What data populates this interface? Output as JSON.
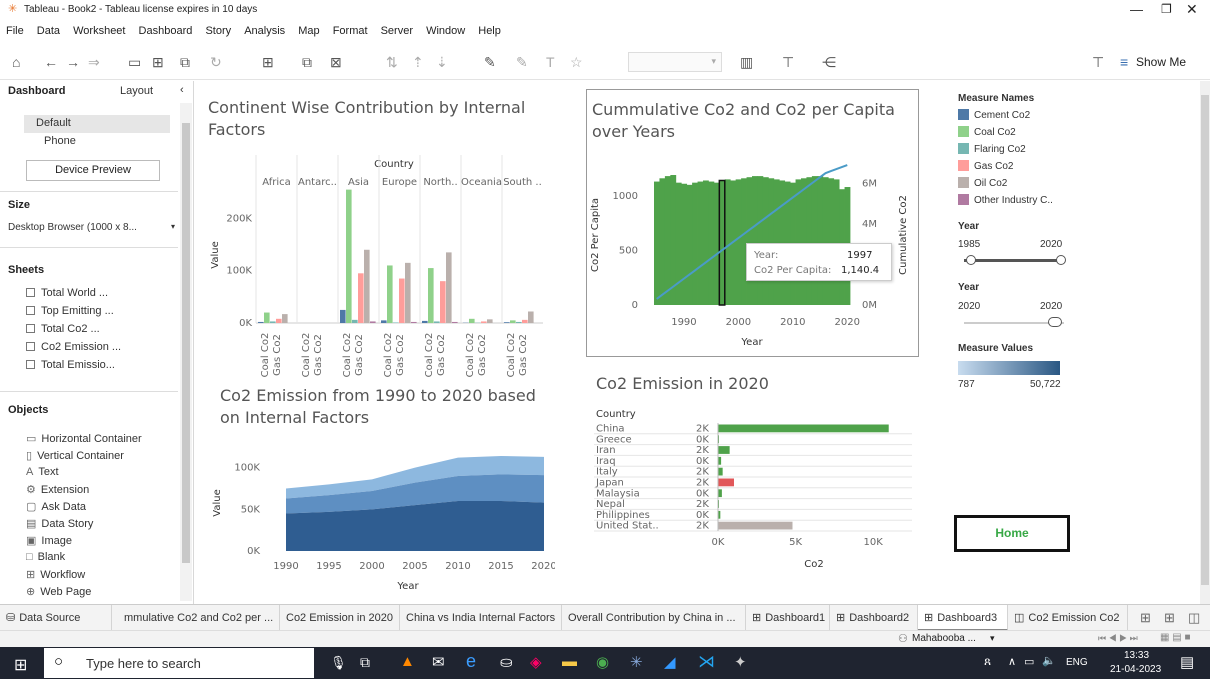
{
  "window": {
    "title": "Tableau - Book2 - Tableau license expires in 10 days"
  },
  "menu": [
    "File",
    "Data",
    "Worksheet",
    "Dashboard",
    "Story",
    "Analysis",
    "Map",
    "Format",
    "Server",
    "Window",
    "Help"
  ],
  "toolbar": {
    "show_me": "Show Me"
  },
  "left_pane": {
    "tab_dashboard": "Dashboard",
    "tab_layout": "Layout",
    "devices": [
      "Default",
      "Phone"
    ],
    "device_preview": "Device Preview",
    "size_heading": "Size",
    "size_value": "Desktop Browser (1000 x 8...",
    "sheets_heading": "Sheets",
    "sheets": [
      "Total World ...",
      "Top Emitting ...",
      "Total Co2 ...",
      "Co2 Emission ...",
      "Total Emissio..."
    ],
    "objects_heading": "Objects",
    "objects": [
      "Horizontal Container",
      "Vertical Container",
      "Text",
      "Extension",
      "Ask Data",
      "Data Story",
      "Image",
      "Blank",
      "Workflow",
      "Web Page"
    ]
  },
  "chart1": {
    "title": "Continent Wise Contribution by Internal Factors",
    "header": "Country",
    "ylabel": "Value"
  },
  "chart2": {
    "title": "Cummulative Co2 and Co2 per Capita over Years",
    "ylabel": "Co2 Per Capita",
    "y2label": "Cumulative Co2",
    "xlabel": "Year",
    "tooltip": {
      "year_label": "Year:",
      "year_value": "1997",
      "capita_label": "Co2 Per Capita:",
      "capita_value": "1,140.4"
    }
  },
  "chart3": {
    "title": "Co2 Emission from 1990 to 2020 based on Internal Factors",
    "ylabel": "Value",
    "xlabel": "Year"
  },
  "chart4": {
    "title": "Co2 Emission in 2020",
    "header": "Country",
    "xlabel": "Co2"
  },
  "legend": {
    "measure_names": "Measure Names",
    "items": [
      {
        "label": "Cement Co2",
        "color": "#4e79a7"
      },
      {
        "label": "Coal Co2",
        "color": "#8fd18a"
      },
      {
        "label": "Flaring Co2",
        "color": "#76b7b2"
      },
      {
        "label": "Gas Co2",
        "color": "#ff9d9a"
      },
      {
        "label": "Oil Co2",
        "color": "#bab0ac"
      },
      {
        "label": "Other Industry C..",
        "color": "#b07aa1"
      }
    ],
    "year1": {
      "label": "Year",
      "min": "1985",
      "max": "2020"
    },
    "year2": {
      "label": "Year",
      "min": "2020",
      "max": "2020"
    },
    "measure_values": {
      "label": "Measure Values",
      "min": "787",
      "max": "50,722"
    },
    "home_button": "Home"
  },
  "tabs": [
    "Data Source",
    "mmulative Co2 and Co2 per ...",
    "Co2 Emission in 2020",
    "China vs India Internal Factors",
    "Overall Contribution by China in ...",
    "Dashboard1",
    "Dashboard2",
    "Dashboard3",
    "Co2 Emission Co2"
  ],
  "status": {
    "user": "Mahabooba ..."
  },
  "taskbar": {
    "search_placeholder": "Type here to search",
    "lang": "ENG",
    "time": "13:33",
    "date": "21-04-2023"
  },
  "chart_data": [
    {
      "type": "bar",
      "title": "Continent Wise Contribution by Internal Factors",
      "ylabel": "Value",
      "ylim": [
        0,
        260000
      ],
      "categories": [
        "Africa",
        "Antarc..",
        "Asia",
        "Europe",
        "North..",
        "Oceania",
        "South .."
      ],
      "series": [
        {
          "name": "Cement Co2",
          "values": [
            2000,
            0,
            25000,
            5000,
            4000,
            500,
            1500
          ]
        },
        {
          "name": "Coal Co2",
          "values": [
            20000,
            0,
            255000,
            110000,
            105000,
            8000,
            5000
          ]
        },
        {
          "name": "Flaring Co2",
          "values": [
            3000,
            0,
            6000,
            1000,
            3000,
            500,
            2000
          ]
        },
        {
          "name": "Gas Co2",
          "values": [
            8000,
            0,
            95000,
            85000,
            80000,
            3000,
            6000
          ]
        },
        {
          "name": "Oil Co2",
          "values": [
            17000,
            0,
            140000,
            115000,
            135000,
            7000,
            22000
          ]
        },
        {
          "name": "Other Industry Co2",
          "values": [
            0,
            0,
            3000,
            2000,
            2000,
            0,
            0
          ]
        }
      ],
      "yticks": [
        "0K",
        "100K",
        "200K"
      ]
    },
    {
      "type": "bar",
      "title": "Cummulative Co2 and Co2 per Capita over Years",
      "x": [
        1985,
        2020
      ],
      "ylabel": "Co2 Per Capita",
      "ylim": [
        0,
        1300
      ],
      "y2label": "Cumulative Co2",
      "y2lim": [
        0,
        7000000
      ],
      "bar_values": [
        1130,
        1160,
        1180,
        1190,
        1120,
        1110,
        1100,
        1120,
        1130,
        1140,
        1130,
        1120,
        1140,
        1150,
        1140,
        1150,
        1160,
        1170,
        1180,
        1180,
        1170,
        1160,
        1150,
        1140,
        1130,
        1120,
        1150,
        1160,
        1170,
        1180,
        1180,
        1170,
        1160,
        1150,
        1060,
        1080
      ],
      "line_values": [
        0.3,
        0.5,
        0.7,
        0.9,
        1.1,
        1.3,
        1.5,
        1.7,
        1.9,
        2.1,
        2.3,
        2.5,
        2.7,
        2.9,
        3.1,
        3.3,
        3.5,
        3.7,
        3.9,
        4.1,
        4.3,
        4.5,
        4.7,
        4.9,
        5.1,
        5.3,
        5.5,
        5.7,
        5.9,
        6.1,
        6.3,
        6.5,
        6.6,
        6.7,
        6.8,
        6.9
      ],
      "xticks": [
        "1990",
        "2000",
        "2010",
        "2020"
      ],
      "yticks": [
        "0",
        "500",
        "1000"
      ],
      "y2ticks": [
        "0M",
        "4M",
        "6M"
      ]
    },
    {
      "type": "area",
      "title": "Co2 Emission from 1990 to 2020 based on Internal Factors",
      "ylabel": "Value",
      "xlabel": "Year",
      "ylim": [
        0,
        120000
      ],
      "x": [
        1990,
        1995,
        2000,
        2005,
        2010,
        2015,
        2020
      ],
      "series": [
        {
          "name": "Oil Co2",
          "values": [
            45000,
            47000,
            50000,
            55000,
            60000,
            60000,
            58000
          ]
        },
        {
          "name": "Gas Co2",
          "values": [
            18000,
            20000,
            22000,
            27000,
            30000,
            32000,
            33000
          ]
        },
        {
          "name": "Coal Co2",
          "values": [
            12000,
            13000,
            14000,
            18000,
            22000,
            22000,
            22000
          ]
        }
      ],
      "xticks": [
        "1990",
        "1995",
        "2000",
        "2005",
        "2010",
        "2015",
        "2020"
      ],
      "yticks": [
        "0K",
        "50K",
        "100K"
      ]
    },
    {
      "type": "bar",
      "title": "Co2 Emission in 2020",
      "xlabel": "Co2",
      "categories": [
        "China",
        "Greece",
        "Iran",
        "Iraq",
        "Italy",
        "Japan",
        "Malaysia",
        "Nepal",
        "Philippines",
        "United Stat.."
      ],
      "values": [
        11000,
        20,
        750,
        200,
        300,
        1030,
        250,
        10,
        150,
        4800
      ],
      "row_values": [
        "2K",
        "0K",
        "2K",
        "0K",
        "2K",
        "2K",
        "0K",
        "2K",
        "0K",
        "2K"
      ],
      "xticks": [
        "0K",
        "5K",
        "10K"
      ]
    }
  ]
}
